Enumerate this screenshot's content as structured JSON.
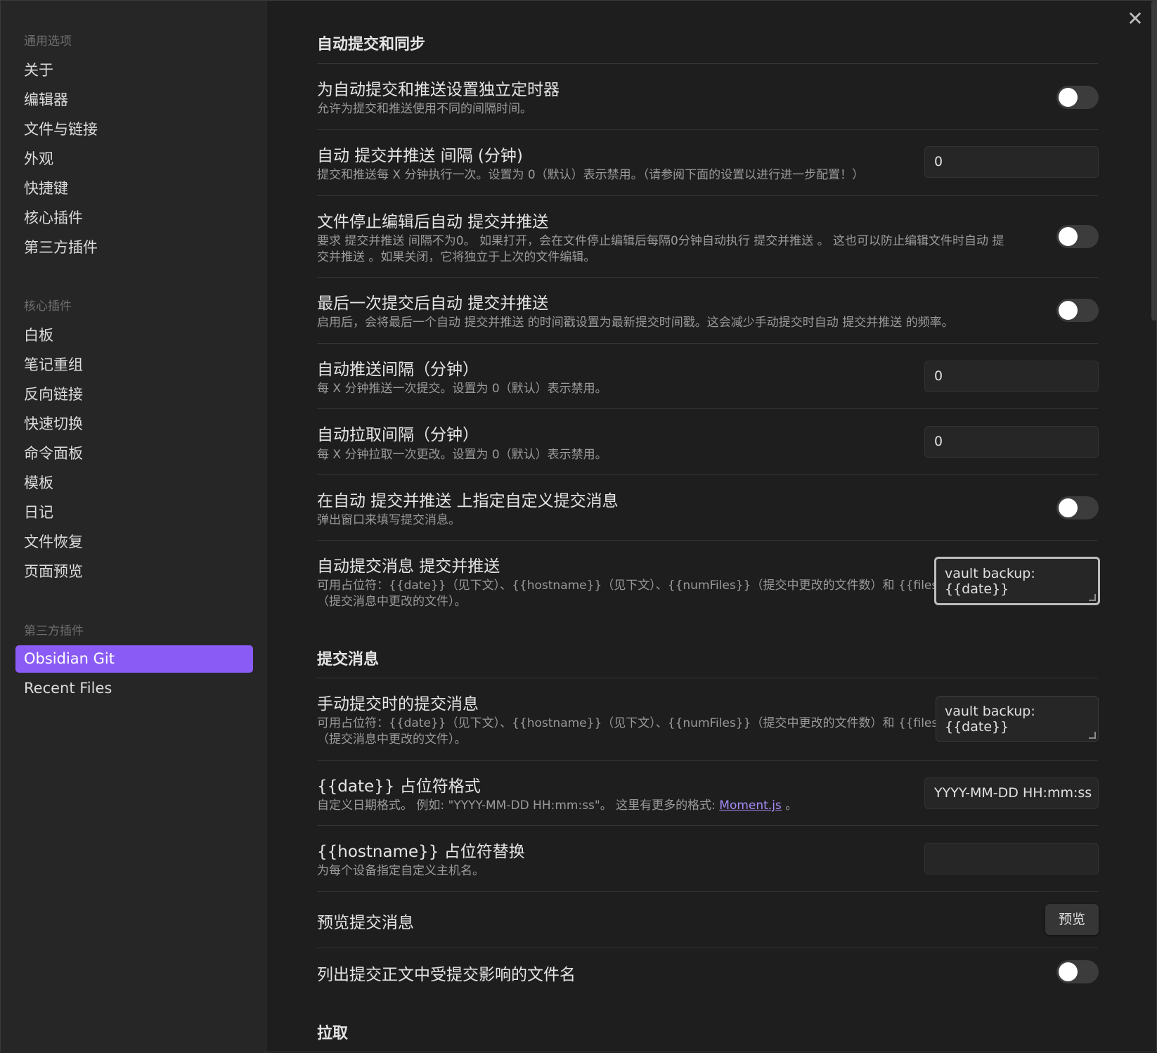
{
  "sidebar": {
    "group_general": "通用选项",
    "general_items": [
      "关于",
      "编辑器",
      "文件与链接",
      "外观",
      "快捷键",
      "核心插件",
      "第三方插件"
    ],
    "group_core": "核心插件",
    "core_items": [
      "白板",
      "笔记重组",
      "反向链接",
      "快速切换",
      "命令面板",
      "模板",
      "日记",
      "文件恢复",
      "页面预览"
    ],
    "group_community": "第三方插件",
    "community_items": [
      "Obsidian Git",
      "Recent Files"
    ],
    "active_item": "Obsidian Git"
  },
  "sections": {
    "auto_commit": "自动提交和同步",
    "commit_message": "提交消息",
    "pull": "拉取"
  },
  "settings": {
    "separate_timer": {
      "name": "为自动提交和推送设置独立定时器",
      "desc": "允许为提交和推送使用不同的间隔时间。",
      "enabled": false
    },
    "commit_push_interval": {
      "name": "自动 提交并推送 间隔 (分钟)",
      "desc": "提交和推送每 X 分钟执行一次。设置为 0（默认）表示禁用。（请参阅下面的设置以进行进一步配置！）",
      "value": "0"
    },
    "after_stop_editing": {
      "name": "文件停止编辑后自动 提交并推送",
      "desc1": "要求 提交并推送 间隔不为0。 如果打开，会在文件停止编辑后每隔0分钟自动执行 提交并推送 。 这也可以防止编辑文件时自动 提",
      "desc2": "交并推送 。如果关闭，它将独立于上次的文件编辑。",
      "enabled": false
    },
    "after_latest_commit": {
      "name": "最后一次提交后自动 提交并推送",
      "desc": "启用后，会将最后一个自动 提交并推送 的时间戳设置为最新提交时间戳。这会减少手动提交时自动 提交并推送 的频率。",
      "enabled": false
    },
    "push_interval": {
      "name": "自动推送间隔（分钟）",
      "desc": "每 X 分钟推送一次提交。设置为 0（默认）表示禁用。",
      "value": "0"
    },
    "pull_interval": {
      "name": "自动拉取间隔（分钟）",
      "desc": "每 X 分钟拉取一次更改。设置为 0（默认）表示禁用。",
      "value": "0"
    },
    "custom_message_prompt": {
      "name": "在自动 提交并推送 上指定自定义提交消息",
      "desc": "弹出窗口来填写提交消息。",
      "enabled": false
    },
    "auto_commit_message": {
      "name": "自动提交消息 提交并推送",
      "desc1": "可用占位符：{{date}}（见下文）、{{hostname}}（见下文）、{{numFiles}}（提交中更改的文件数）和 {{files}}",
      "desc2": "（提交消息中更改的文件）。",
      "value": "vault backup: {{date}}"
    },
    "manual_commit_message": {
      "name": "手动提交时的提交消息",
      "desc1": "可用占位符：{{date}}（见下文）、{{hostname}}（见下文）、{{numFiles}}（提交中更改的文件数）和 {{files}}",
      "desc2": "（提交消息中更改的文件）。",
      "value": "vault backup: {{date}}"
    },
    "date_format": {
      "name": "{{date}} 占位符格式",
      "desc_prefix": "自定义日期格式。 例如: \"YYYY-MM-DD HH:mm:ss\"。 这里有更多的格式: ",
      "desc_link": "Moment.js",
      "desc_suffix": " 。",
      "value": "YYYY-MM-DD HH:mm:ss"
    },
    "hostname": {
      "name": "{{hostname}} 占位符替换",
      "desc": "为每个设备指定自定义主机名。",
      "value": ""
    },
    "preview_message": {
      "name": "预览提交消息",
      "button": "预览"
    },
    "list_files": {
      "name": "列出提交正文中受提交影响的文件名",
      "enabled": false
    }
  },
  "close_label": "✕"
}
